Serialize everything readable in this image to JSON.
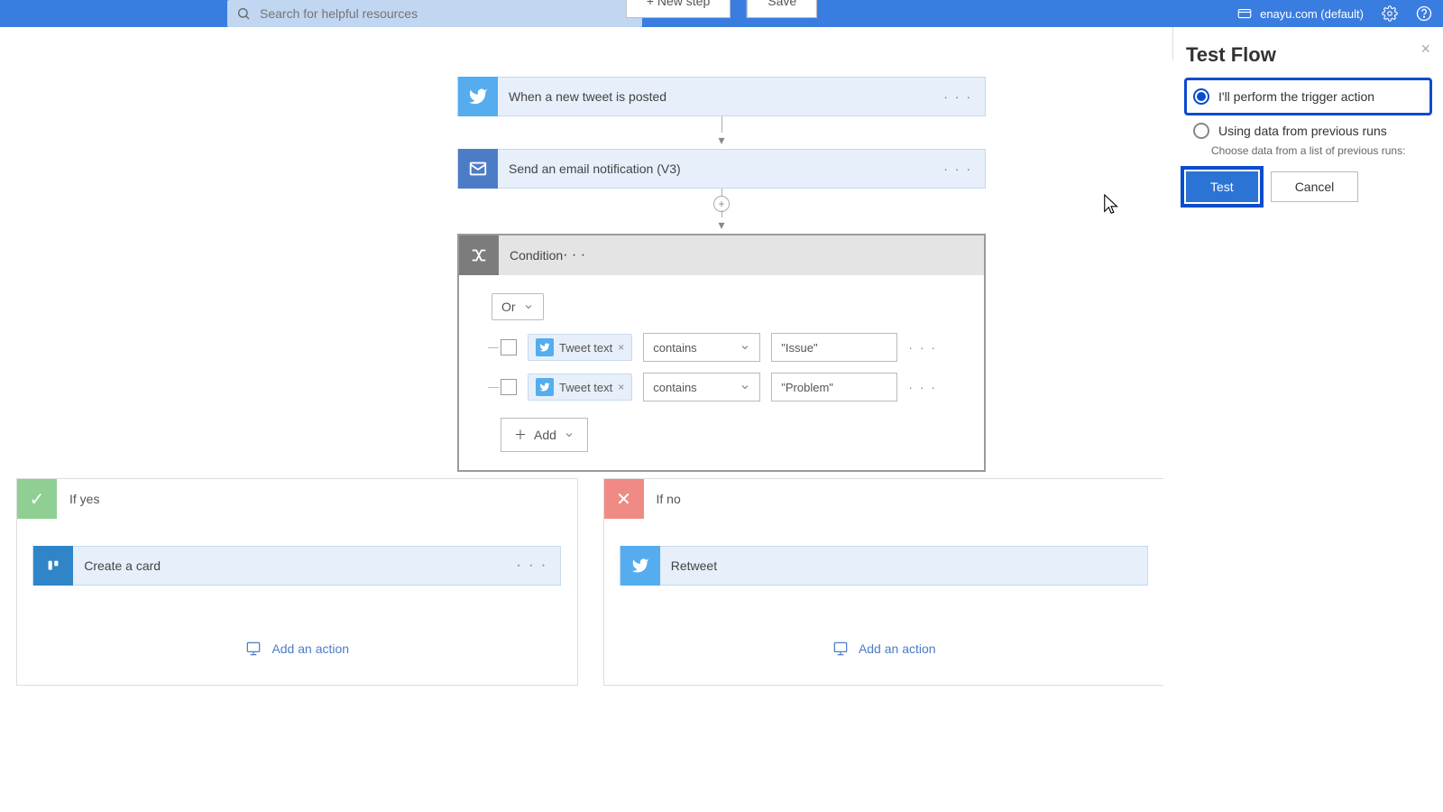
{
  "header": {
    "search_placeholder": "Search for helpful resources",
    "environment": "enayu.com (default)"
  },
  "flow": {
    "trigger": {
      "title": "When a new tweet is posted"
    },
    "action1": {
      "title": "Send an email notification (V3)"
    },
    "condition": {
      "title": "Condition",
      "group_op": "Or",
      "rows": [
        {
          "token": "Tweet text",
          "operator": "contains",
          "value": "\"Issue\""
        },
        {
          "token": "Tweet text",
          "operator": "contains",
          "value": "\"Problem\""
        }
      ],
      "add_label": "Add"
    },
    "branches": {
      "yes": {
        "title": "If yes",
        "card": "Create a card",
        "add": "Add an action"
      },
      "no": {
        "title": "If no",
        "card": "Retweet",
        "add": "Add an action"
      }
    },
    "footer": {
      "new_step": "+ New step",
      "save": "Save"
    }
  },
  "panel": {
    "title": "Test Flow",
    "opt1": "I'll perform the trigger action",
    "opt2": "Using data from previous runs",
    "opt2_note": "Choose data from a list of previous runs:",
    "test": "Test",
    "cancel": "Cancel"
  }
}
